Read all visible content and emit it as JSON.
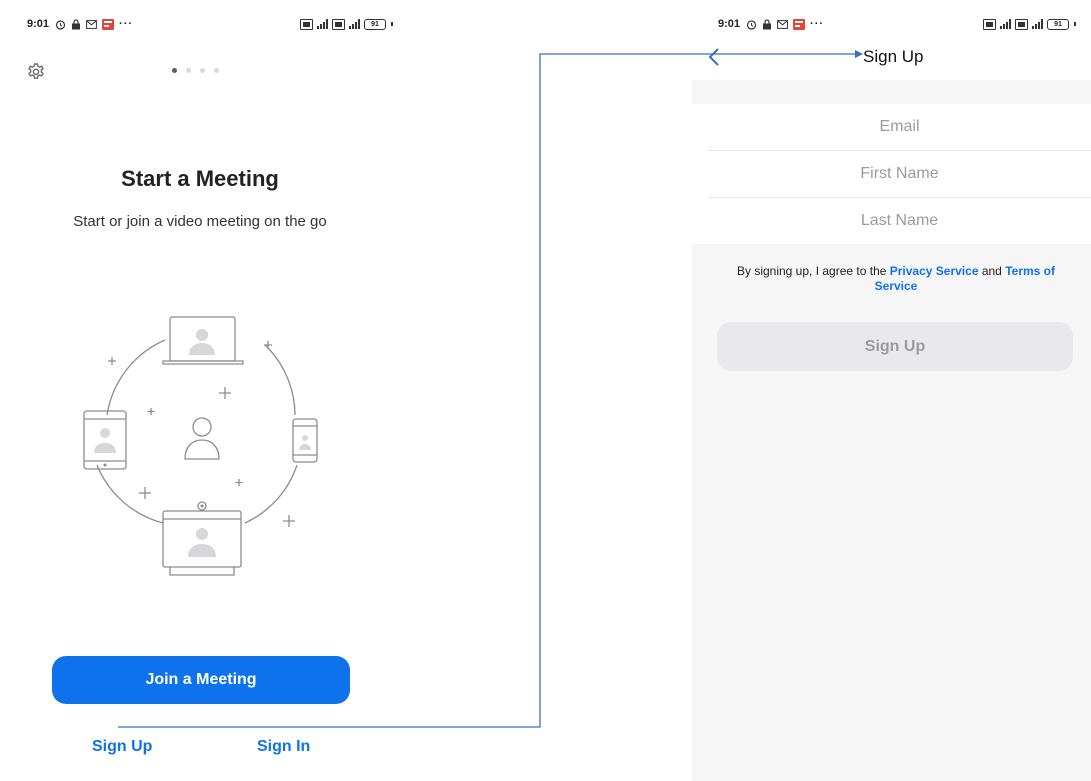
{
  "left_screen": {
    "status_bar": {
      "time": "9:01",
      "more": "···",
      "battery": "91"
    },
    "title": "Start a Meeting",
    "subtitle": "Start or join a video meeting on the go",
    "page_indicator": {
      "count": 4,
      "active_index": 0
    },
    "join_button": "Join a Meeting",
    "sign_up_link": "Sign Up",
    "sign_in_link": "Sign In"
  },
  "right_screen": {
    "status_bar": {
      "time": "9:01",
      "more": "···",
      "battery": "91"
    },
    "header_title": "Sign Up",
    "fields": {
      "email_placeholder": "Email",
      "first_name_placeholder": "First Name",
      "last_name_placeholder": "Last Name"
    },
    "agreement": {
      "prefix": "By signing up, I agree to the ",
      "privacy_link": "Privacy Service",
      "middle": " and ",
      "terms_link": "Terms of Service"
    },
    "sign_up_button": "Sign Up"
  },
  "colors": {
    "accent": "#0e72ed",
    "annotation_line": "#3b6fc0",
    "disabled_button": "#e9e9ed",
    "icon_gray": "#8b8b93"
  },
  "icons": [
    "settings-gear-icon",
    "back-arrow-icon",
    "alarm-icon",
    "lock-icon",
    "mail-icon",
    "signal-icon",
    "battery-icon",
    "illustration-devices"
  ]
}
